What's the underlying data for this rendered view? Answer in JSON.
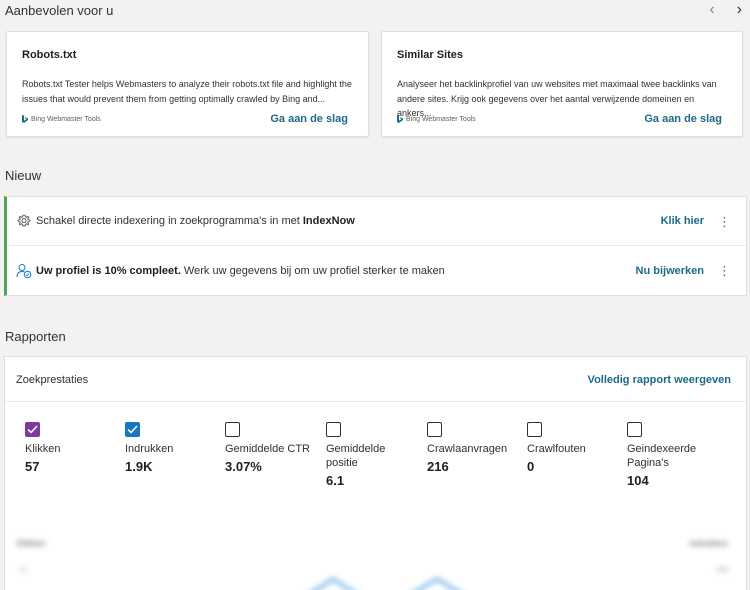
{
  "recommended": {
    "title": "Aanbevolen voor u",
    "nav_prev": "‹",
    "nav_next": "›",
    "cards": [
      {
        "title": "Robots.txt",
        "description": "Robots.txt Tester helps Webmasters to analyze their robots.txt file and highlight the issues that would prevent them from getting optimally crawled by Bing and...",
        "brand": "Bing Webmaster Tools",
        "cta": "Ga aan de slag"
      },
      {
        "title": "Similar Sites",
        "description": "Analyseer het backlinkprofiel van uw websites met maximaal twee backlinks van andere sites. Krijg ook gegevens over het aantal verwijzende domeinen en ankers...",
        "brand": "Bing Webmaster Tools",
        "cta": "Ga aan de slag"
      }
    ]
  },
  "news": {
    "title": "Nieuw",
    "items": [
      {
        "icon": "gear-icon",
        "text_prefix": "Schakel directe indexering in zoekprogramma's in met ",
        "text_bold": "IndexNow",
        "text_suffix": "",
        "link": "Klik hier",
        "more": "⋮"
      },
      {
        "icon": "profile-icon",
        "text_prefix": "",
        "text_bold": "Uw profiel is 10% compleet.",
        "text_suffix": " Werk uw gegevens bij om uw profiel sterker te maken",
        "link": "Nu bijwerken",
        "more": "⋮"
      }
    ]
  },
  "reports": {
    "title": "Rapporten",
    "card_title": "Zoekprestaties",
    "full_report_link": "Volledig rapport weergeven",
    "metrics": [
      {
        "label": "Klikken",
        "value": "57",
        "checked": true,
        "color": "#7c3aa1"
      },
      {
        "label": "Indrukken",
        "value": "1.9K",
        "checked": true,
        "color": "#1976c2"
      },
      {
        "label": "Gemiddelde CTR",
        "value": "3.07%",
        "checked": false
      },
      {
        "label": "Gemiddelde positie",
        "value": "6.1",
        "checked": false
      },
      {
        "label": "Crawlaanvragen",
        "value": "216",
        "checked": false
      },
      {
        "label": "Crawlfouten",
        "value": "0",
        "checked": false
      },
      {
        "label": "Geindexeerde Pagina's",
        "value": "104",
        "checked": false
      }
    ],
    "chart_labels": {
      "left": "Klikken",
      "right": "Indrukken",
      "left_tick": "10",
      "right_tick": "300"
    }
  },
  "colors": {
    "accent_link": "#1c6a8a",
    "news_border": "#4ba55c",
    "clicks": "#7c3aa1",
    "impressions": "#1976c2"
  }
}
